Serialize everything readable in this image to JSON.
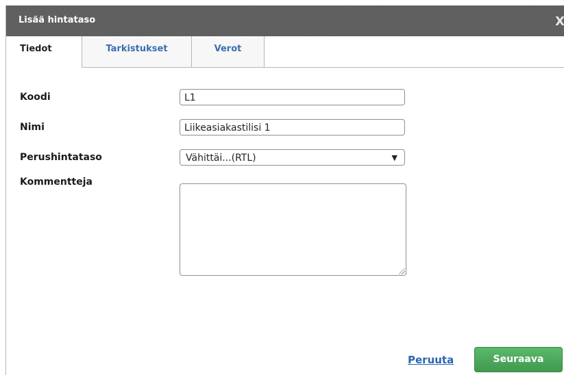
{
  "dialog": {
    "title": "Lisää hintataso",
    "close_label": "X"
  },
  "tabs": [
    {
      "label": "Tiedot",
      "active": true
    },
    {
      "label": "Tarkistukset",
      "active": false
    },
    {
      "label": "Verot",
      "active": false
    }
  ],
  "form": {
    "koodi": {
      "label": "Koodi",
      "value": "L1"
    },
    "nimi": {
      "label": "Nimi",
      "value": "Liikeasiakastilisi 1"
    },
    "perushintataso": {
      "label": "Perushintataso",
      "selected": "Vähittäi...(RTL)"
    },
    "kommentteja": {
      "label": "Kommentteja",
      "value": ""
    }
  },
  "footer": {
    "cancel_label": "Peruuta",
    "next_label": "Seuraava"
  },
  "colors": {
    "titlebar": "#5e5e5e",
    "tab_link": "#3b6eb0",
    "primary_button": "#4aa85a",
    "link": "#2a66b0"
  },
  "icons": {
    "close": "close-icon",
    "dropdown": "chevron-down-icon",
    "resize": "resize-handle-icon"
  }
}
